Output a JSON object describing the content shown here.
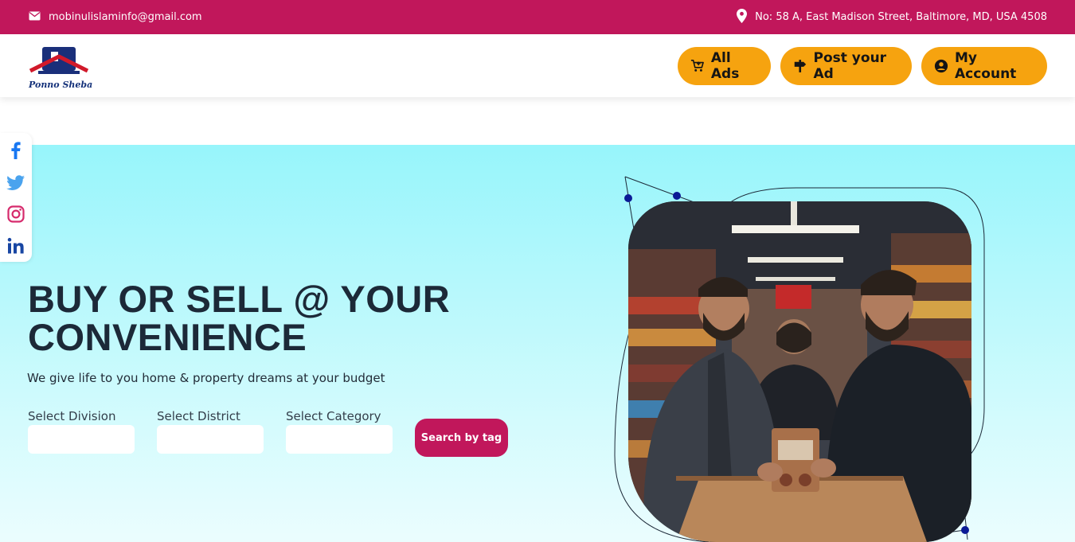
{
  "topbar": {
    "email": "mobinulislaminfo@gmail.com",
    "address": "No: 58 A, East Madison Street, Baltimore, MD, USA 4508"
  },
  "logo": {
    "text": "Ponno Sheba"
  },
  "nav": {
    "all_ads": "All Ads",
    "post_ad": "Post your Ad",
    "my_account": "My Account"
  },
  "social": [
    "facebook-icon",
    "twitter-icon",
    "instagram-icon",
    "linkedin-icon"
  ],
  "hero": {
    "headline_line1": "BUY OR SELL @ YOUR",
    "headline_line2": "CONVENIENCE",
    "subtitle": "We give life to you home & property dreams at your budget",
    "division_label": "Select Division",
    "district_label": "Select District",
    "category_label": "Select Category",
    "search_button": "Search by tag"
  },
  "colors": {
    "brand": "#c1175b",
    "accent": "#f6a30f",
    "hero_top": "#97f5fb",
    "dots": "#0b1a96"
  }
}
